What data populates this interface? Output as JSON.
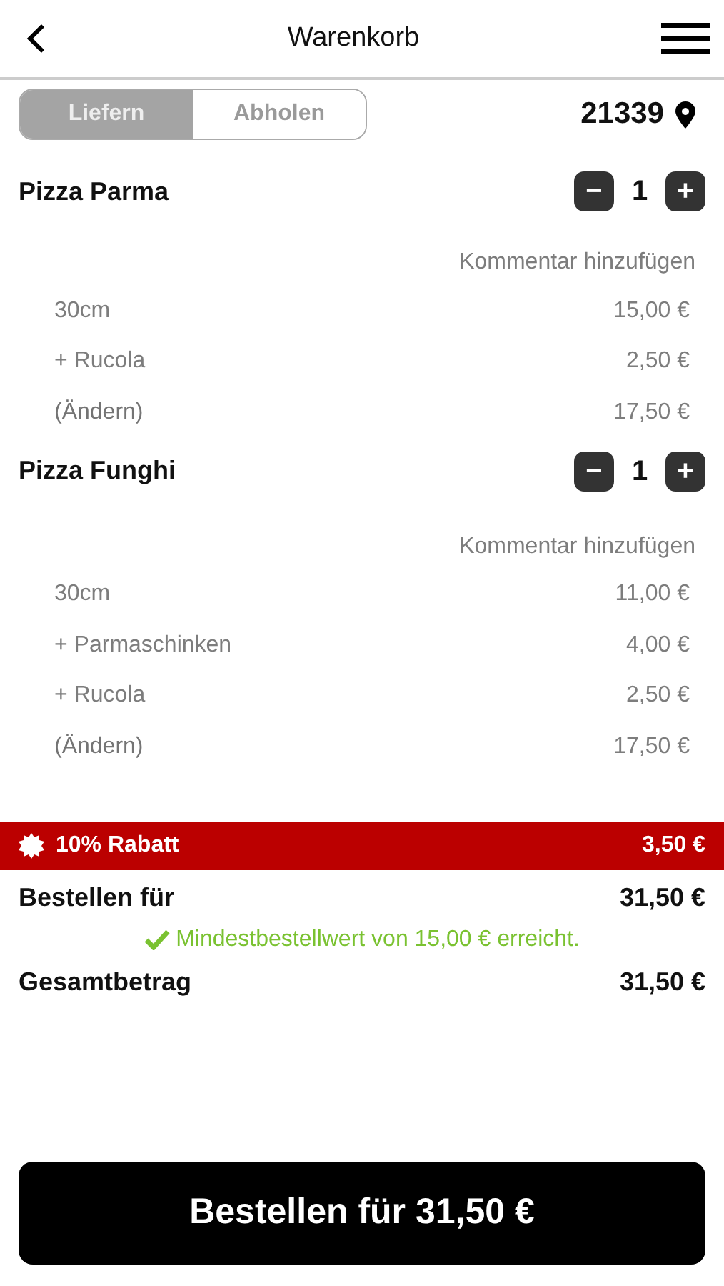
{
  "header": {
    "title": "Warenkorb"
  },
  "delivery": {
    "modes": [
      {
        "label": "Liefern",
        "selected": true
      },
      {
        "label": "Abholen",
        "selected": false
      }
    ],
    "postcode": "21339"
  },
  "items": [
    {
      "name": "Pizza Parma",
      "quantity": "1",
      "minus": "−",
      "plus": "+",
      "comment": "Kommentar hinzufügen",
      "lines": [
        {
          "kind": "option",
          "label": "30cm",
          "price": "15,00 €"
        },
        {
          "kind": "option",
          "label": "+ Rucola",
          "price": "2,50 €"
        },
        {
          "kind": "edit",
          "label": "(Ändern)",
          "price": "17,50 €"
        }
      ]
    },
    {
      "name": "Pizza Funghi",
      "quantity": "1",
      "minus": "−",
      "plus": "+",
      "comment": "Kommentar hinzufügen",
      "lines": [
        {
          "kind": "option",
          "label": "30cm",
          "price": "11,00 €"
        },
        {
          "kind": "option",
          "label": "+ Parmaschinken",
          "price": "4,00 €"
        },
        {
          "kind": "option",
          "label": "+ Rucola",
          "price": "2,50 €"
        },
        {
          "kind": "edit",
          "label": "(Ändern)",
          "price": "17,50 €"
        }
      ]
    }
  ],
  "discount": {
    "label": "10% Rabatt",
    "amount": "3,50 €"
  },
  "summary": {
    "order_label": "Bestellen für",
    "order_amount": "31,50 €",
    "minimum_note": "Mindestbestellwert von 15,00 € erreicht.",
    "minimum_reached": true,
    "total_label": "Gesamtbetrag",
    "total_amount": "31,50 €"
  },
  "checkout_button": "Bestellen für 31,50 €"
}
